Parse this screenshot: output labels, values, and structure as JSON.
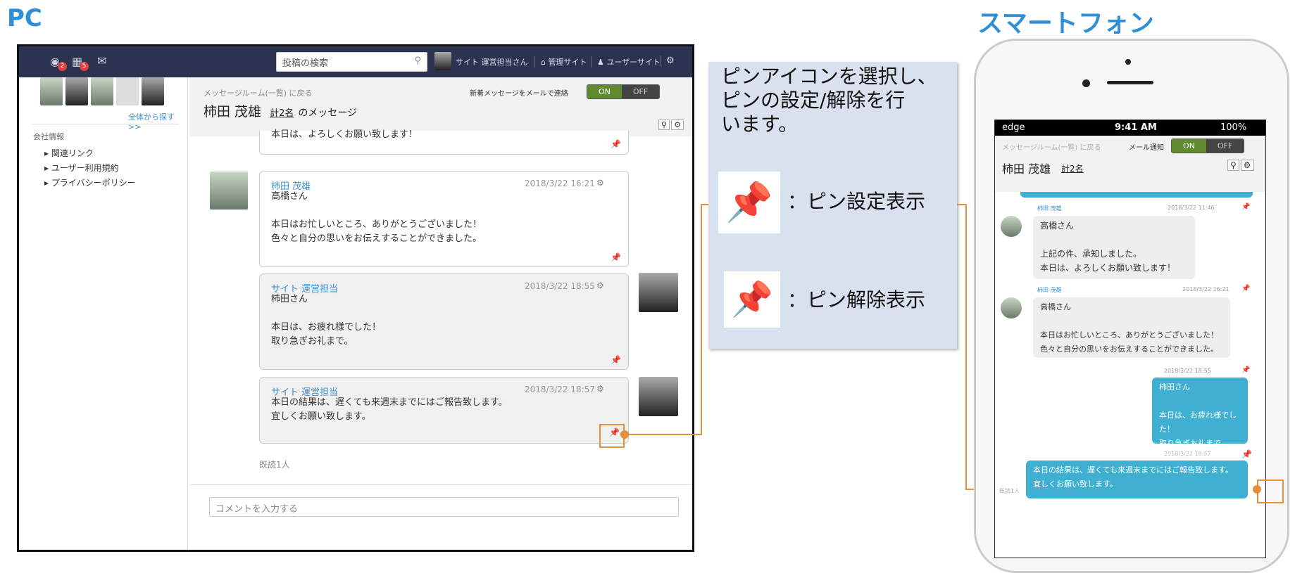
{
  "labels": {
    "pc": "PC",
    "smartphone": "スマートフォン"
  },
  "pc": {
    "topbar": {
      "badge_a": "2",
      "badge_b": "5",
      "search_placeholder": "投稿の検索",
      "user": "サイト 運営担当さん",
      "admin_site": "管理サイト",
      "user_site": "ユーザーサイト"
    },
    "sidebar": {
      "search_all": "全体から探す>>",
      "section_title": "会社情報",
      "links": [
        "関連リンク",
        "ユーザー利用規約",
        "プライバシーポリシー"
      ]
    },
    "header": {
      "back_link": "メッセージルーム(一覧) に戻る",
      "notify_label": "新着メッセージをメールで連絡",
      "toggle_on": "ON",
      "toggle_off": "OFF",
      "title_name": "柿田 茂雄",
      "title_count": "計2名",
      "title_suffix": "のメッセージ"
    },
    "messages": [
      {
        "body": "本日は、よろしくお願い致します！"
      },
      {
        "name": "柿田 茂雄",
        "date": "2018/3/22 16:21",
        "body": "高橋さん\n\n本日はお忙しいところ、ありがとうございました！\n色々と自分の思いをお伝えすることができました。"
      },
      {
        "name": "サイト 運営担当",
        "date": "2018/3/22 18:55",
        "body": "柿田さん\n\n本日は、お疲れ様でした！\n取り急ぎお礼まで。"
      },
      {
        "name": "サイト 運営担当",
        "date": "2018/3/22 18:57",
        "body": "本日の結果は、遅くても来週末までにはご報告致します。\n宜しくお願い致します。"
      }
    ],
    "read_status": "既読1人",
    "comment_placeholder": "コメントを入力する"
  },
  "callout": {
    "description": "ピンアイコンを選択し、\nピンの設定/解除を行\nいます。",
    "pin_on_label": "：ピン設定表示",
    "pin_off_label": "：ピン解除表示"
  },
  "phone": {
    "status": {
      "carrier": "edge",
      "time": "9:41 AM",
      "battery": "100%"
    },
    "back_link": "メッセージルーム(一覧) に戻る",
    "mail_notify": "メール通知",
    "toggle_on": "ON",
    "toggle_off": "OFF",
    "title_name": "柿田 茂雄",
    "title_count": "計2名",
    "messages": [
      {
        "name": "柿田 茂雄",
        "date": "2018/3/22 11:46",
        "body": "高橋さん\n\n上記の件、承知しました。\n本日は、よろしくお願い致します！"
      },
      {
        "name": "柿田 茂雄",
        "date": "2018/3/22 16:21",
        "body": "高橋さん\n\n本日はお忙しいところ、ありがとうございました！\n色々と自分の思いをお伝えすることができました。"
      },
      {
        "date": "2018/3/22 18:55",
        "body": "柿田さん\n\n本日は、お疲れ様でした！\n取り急ぎお礼まで。"
      },
      {
        "date": "2018/3/22 18:57",
        "body": "本日の結果は、遅くても来週末までにはご報告致します。\n宜しくお願い致します。"
      }
    ],
    "read_status": "既読1人"
  },
  "colors": {
    "accent": "#2e8fd6",
    "orange": "#e58e3c",
    "pin_red": "#d62020",
    "bubble_blue": "#3fb0d2"
  }
}
